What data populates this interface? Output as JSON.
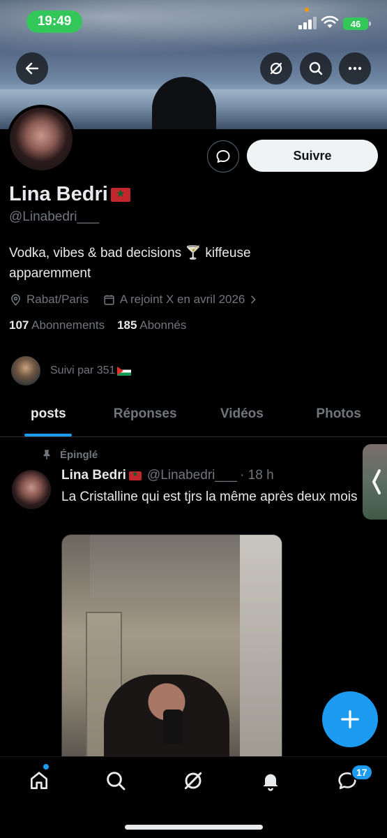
{
  "status_bar": {
    "time": "19:49",
    "battery": "46"
  },
  "header": {
    "back_icon": "arrow-left-icon",
    "grok_icon": "grok-icon",
    "search_icon": "search-icon",
    "more_icon": "more-icon"
  },
  "profile": {
    "name": "Lina Bedri",
    "handle": "@Linabedri___",
    "bio": "Vodka, vibes & bad decisions 🍸 kiffeuse apparemment",
    "location": "Rabat/Paris",
    "joined": "A rejoint X en avril 2026",
    "following_count": "107",
    "following_label": "Abonnements",
    "followers_count": "185",
    "followers_label": "Abonnés",
    "followed_by": "Suivi par 351",
    "follow_button": "Suivre"
  },
  "tabs": [
    {
      "label": "posts",
      "active": true
    },
    {
      "label": "Réponses",
      "active": false
    },
    {
      "label": "Vidéos",
      "active": false
    },
    {
      "label": "Photos",
      "active": false
    }
  ],
  "post": {
    "pinned_label": "Épinglé",
    "author": "Lina Bedri",
    "handle": "@Linabedri___",
    "time": "· 18 h",
    "text": "La Cristalline qui est tjrs la même après deux mois"
  },
  "bottom_nav": {
    "items": [
      "home-icon",
      "search-icon",
      "grok-icon",
      "bell-icon",
      "messages-icon"
    ],
    "messages_badge": "17"
  },
  "colors": {
    "accent": "#1d9bf0",
    "background": "#000000",
    "secondary_text": "#71767b"
  }
}
